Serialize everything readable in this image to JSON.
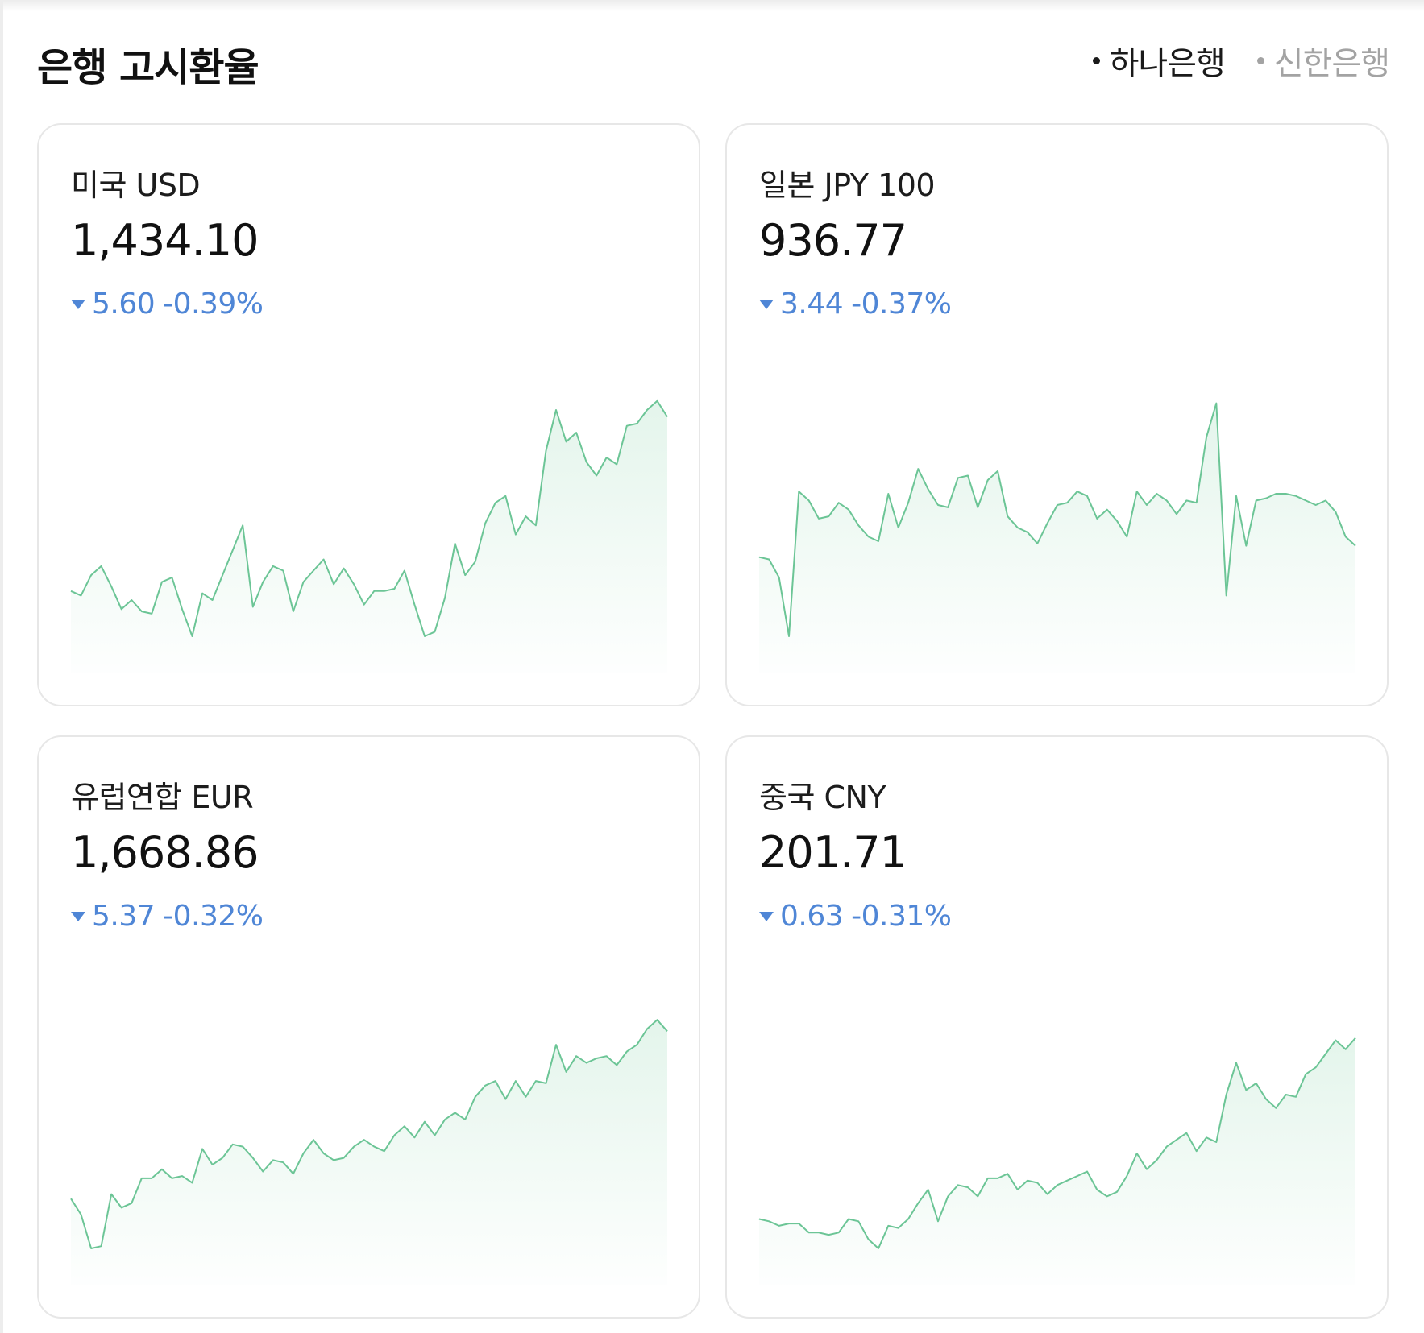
{
  "header": {
    "title": "은행 고시환율",
    "banks": [
      {
        "label": "하나은행",
        "active": true
      },
      {
        "label": "신한은행",
        "active": false
      }
    ]
  },
  "colors": {
    "line": "#6cc596",
    "fill": "#dff3e8",
    "down": "#4f86d6"
  },
  "cards": [
    {
      "name": "미국 USD",
      "rate": "1,434.10",
      "change_amount": "5.60",
      "change_pct": "-0.39%",
      "direction": "down",
      "chart_data": {
        "type": "area",
        "values": [
          0.2,
          0.18,
          0.27,
          0.31,
          0.22,
          0.12,
          0.16,
          0.11,
          0.1,
          0.24,
          0.26,
          0.12,
          0.0,
          0.19,
          0.16,
          0.27,
          0.38,
          0.49,
          0.13,
          0.24,
          0.31,
          0.29,
          0.11,
          0.24,
          0.29,
          0.34,
          0.23,
          0.3,
          0.23,
          0.14,
          0.2,
          0.2,
          0.21,
          0.29,
          0.14,
          0.0,
          0.02,
          0.17,
          0.41,
          0.27,
          0.33,
          0.5,
          0.59,
          0.62,
          0.45,
          0.53,
          0.49,
          0.82,
          1.0,
          0.86,
          0.9,
          0.77,
          0.71,
          0.79,
          0.76,
          0.93,
          0.94,
          1.0,
          1.04,
          0.97
        ]
      }
    },
    {
      "name": "일본 JPY 100",
      "rate": "936.77",
      "change_amount": "3.44",
      "change_pct": "-0.37%",
      "direction": "down",
      "chart_data": {
        "type": "area",
        "values": [
          0.35,
          0.34,
          0.26,
          0.0,
          0.64,
          0.6,
          0.52,
          0.53,
          0.59,
          0.56,
          0.49,
          0.44,
          0.42,
          0.63,
          0.48,
          0.59,
          0.74,
          0.65,
          0.58,
          0.57,
          0.7,
          0.71,
          0.57,
          0.69,
          0.73,
          0.53,
          0.48,
          0.46,
          0.41,
          0.5,
          0.58,
          0.59,
          0.64,
          0.62,
          0.52,
          0.56,
          0.51,
          0.44,
          0.64,
          0.58,
          0.63,
          0.6,
          0.54,
          0.6,
          0.59,
          0.88,
          1.03,
          0.18,
          0.62,
          0.4,
          0.6,
          0.61,
          0.63,
          0.63,
          0.62,
          0.6,
          0.58,
          0.6,
          0.55,
          0.44,
          0.4
        ]
      }
    },
    {
      "name": "유럽연합 EUR",
      "rate": "1,668.86",
      "change_amount": "5.37",
      "change_pct": "-0.32%",
      "direction": "down",
      "chart_data": {
        "type": "area",
        "values": [
          0.22,
          0.15,
          0.0,
          0.01,
          0.24,
          0.18,
          0.2,
          0.31,
          0.31,
          0.35,
          0.31,
          0.32,
          0.29,
          0.44,
          0.37,
          0.4,
          0.46,
          0.45,
          0.4,
          0.34,
          0.39,
          0.38,
          0.33,
          0.42,
          0.48,
          0.42,
          0.39,
          0.4,
          0.45,
          0.48,
          0.45,
          0.43,
          0.5,
          0.54,
          0.49,
          0.56,
          0.5,
          0.57,
          0.6,
          0.57,
          0.67,
          0.72,
          0.74,
          0.66,
          0.74,
          0.67,
          0.74,
          0.73,
          0.9,
          0.78,
          0.85,
          0.82,
          0.84,
          0.85,
          0.81,
          0.87,
          0.9,
          0.97,
          1.01,
          0.96
        ]
      }
    },
    {
      "name": "중국 CNY",
      "rate": "201.71",
      "change_amount": "0.63",
      "change_pct": "-0.31%",
      "direction": "down",
      "chart_data": {
        "type": "area",
        "values": [
          0.13,
          0.12,
          0.1,
          0.11,
          0.11,
          0.07,
          0.07,
          0.06,
          0.07,
          0.13,
          0.12,
          0.04,
          0.0,
          0.1,
          0.09,
          0.13,
          0.2,
          0.26,
          0.12,
          0.23,
          0.28,
          0.27,
          0.23,
          0.31,
          0.31,
          0.33,
          0.26,
          0.3,
          0.29,
          0.24,
          0.28,
          0.3,
          0.32,
          0.34,
          0.26,
          0.23,
          0.25,
          0.32,
          0.42,
          0.35,
          0.39,
          0.45,
          0.48,
          0.51,
          0.43,
          0.49,
          0.47,
          0.68,
          0.82,
          0.7,
          0.73,
          0.66,
          0.62,
          0.68,
          0.67,
          0.77,
          0.8,
          0.86,
          0.92,
          0.88,
          0.93
        ]
      }
    }
  ]
}
